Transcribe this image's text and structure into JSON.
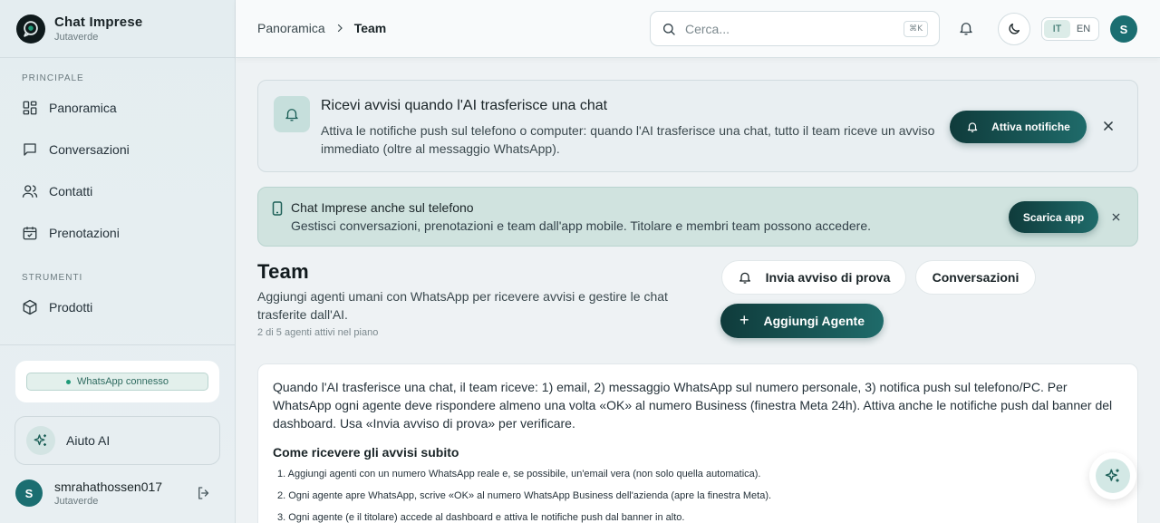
{
  "brand": {
    "title": "Chat Imprese",
    "subtitle": "Jutaverde"
  },
  "sidebar": {
    "section_main": "PRINCIPALE",
    "section_tools": "STRUMENTI",
    "items": [
      {
        "label": "Panoramica",
        "icon": "grid-icon"
      },
      {
        "label": "Conversazioni",
        "icon": "chat-bubble-icon"
      },
      {
        "label": "Contatti",
        "icon": "users-icon"
      },
      {
        "label": "Prenotazioni",
        "icon": "calendar-check-icon"
      },
      {
        "label": "Prodotti",
        "icon": "box-icon"
      }
    ],
    "whatsapp_status": "WhatsApp connesso",
    "help_label": "Aiuto AI",
    "user": {
      "initial": "S",
      "name": "smrahathossen017",
      "org": "Jutaverde"
    }
  },
  "header": {
    "breadcrumb": [
      "Panoramica",
      "Team"
    ],
    "search_placeholder": "Cerca...",
    "search_shortcut": "⌘K",
    "lang": {
      "it": "IT",
      "en": "EN",
      "active": "IT"
    },
    "avatar_initial": "S"
  },
  "notification_banner": {
    "title": "Ricevi avvisi quando l'AI trasferisce una chat",
    "description": "Attiva le notifiche push sul telefono o computer: quando l'AI trasferisce una chat, tutto il team riceve un avviso immediato (oltre al messaggio WhatsApp).",
    "button": "Attiva notifiche"
  },
  "app_banner": {
    "title": "Chat Imprese anche sul telefono",
    "description": "Gestisci conversazioni, prenotazioni e team dall'app mobile. Titolare e membri team possono accedere.",
    "button": "Scarica app"
  },
  "team": {
    "title": "Team",
    "description": "Aggiungi agenti umani con WhatsApp per ricevere avvisi e gestire le chat trasferite dall'AI.",
    "count": "2 di 5 agenti attivi nel piano",
    "btn_test": "Invia avviso di prova",
    "btn_conversations": "Conversazioni",
    "btn_add": "Aggiungi Agente"
  },
  "info": {
    "text": "Quando l'AI trasferisce una chat, il team riceve: 1) email, 2) messaggio WhatsApp sul numero personale, 3) notifica push sul telefono/PC. Per WhatsApp ogni agente deve rispondere almeno una volta «OK» al numero Business (finestra Meta 24h). Attiva anche le notifiche push dal banner del dashboard. Usa «Invia avviso di prova» per verificare.",
    "subtitle": "Come ricevere gli avvisi subito",
    "steps": [
      "1. Aggiungi agenti con un numero WhatsApp reale e, se possibile, un'email vera (non solo quella automatica).",
      "2. Ogni agente apre WhatsApp, scrive «OK» al numero WhatsApp Business dell'azienda (apre la finestra Meta).",
      "3. Ogni agente (e il titolare) accede al dashboard e attiva le notifiche push dal banner in alto."
    ]
  },
  "colors": {
    "accent": "#1f6b6a",
    "accent_dark": "#0f3b3b",
    "success": "#1e9a78"
  }
}
